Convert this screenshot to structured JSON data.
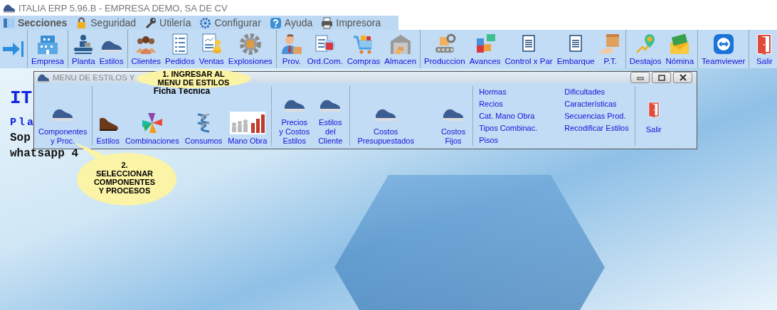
{
  "window": {
    "title": "ITALIA ERP 5.96.B - EMPRESA DEMO, SA DE CV"
  },
  "menu": [
    {
      "label": "Secciones"
    },
    {
      "label": "Seguridad"
    },
    {
      "label": "Utilería"
    },
    {
      "label": "Configurar"
    },
    {
      "label": "Ayuda"
    },
    {
      "label": "Impresora"
    }
  ],
  "toolbar_groups": [
    {
      "items": [
        {
          "label": "Empresa"
        }
      ]
    },
    {
      "items": [
        {
          "label": "Planta"
        },
        {
          "label": "Estilos"
        }
      ]
    },
    {
      "items": [
        {
          "label": "Clientes"
        },
        {
          "label": "Pedidos"
        },
        {
          "label": "Ventas"
        },
        {
          "label": "Explosiones"
        }
      ]
    },
    {
      "items": [
        {
          "label": "Prov."
        },
        {
          "label": "Ord.Com."
        },
        {
          "label": "Compras"
        },
        {
          "label": "Almacen"
        }
      ]
    },
    {
      "items": [
        {
          "label": "Produccion"
        },
        {
          "label": "Avances"
        },
        {
          "label": "Control x Par"
        },
        {
          "label": "Embarque"
        },
        {
          "label": "P.T."
        }
      ]
    },
    {
      "items": [
        {
          "label": "Destajos"
        },
        {
          "label": "Nómina"
        }
      ]
    },
    {
      "items": [
        {
          "label": "Teamviewer"
        }
      ]
    },
    {
      "items": [
        {
          "label": "Salir"
        }
      ]
    }
  ],
  "desktop": {
    "heading": "IT",
    "line_1": "Pla",
    "line_2": "Sop",
    "line_3": "whatsapp 4"
  },
  "styles_menu": {
    "title": "MENU DE ESTILOS Y",
    "groups": [
      {
        "items": [
          {
            "label": "Componentes\ny Proc."
          }
        ]
      },
      {
        "heading": "Ficha Técnica",
        "items": [
          {
            "label": "Estilos"
          },
          {
            "label": "Combinaciones"
          },
          {
            "label": "Consumos"
          },
          {
            "label": "Mano Obra"
          }
        ]
      },
      {
        "items": [
          {
            "label": "Precios\ny Costos\nEstilos"
          },
          {
            "label": "Estilos\ndel\nCliente"
          }
        ]
      },
      {
        "items": [
          {
            "label": "Costos\nPresupuestados"
          },
          {
            "label": "Costos\nFijos"
          }
        ]
      }
    ],
    "links": [
      [
        "Hormas",
        "Recios",
        "Cat. Mano Obra",
        "Tipos Combinac.",
        "Pisos"
      ],
      [
        "Dificultades",
        "Características",
        "Secuencias Prod.",
        "Recodificar Estilos"
      ]
    ],
    "exit": "Salir"
  },
  "callouts": [
    {
      "text": "1. INGRESAR AL\nMENU DE ESTILOS"
    },
    {
      "text": "2.\nSELECCIONAR\nCOMPONENTES\nY PROCESOS"
    }
  ]
}
